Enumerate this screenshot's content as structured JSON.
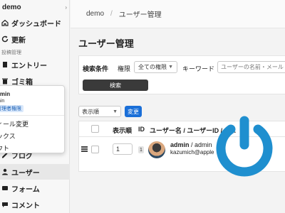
{
  "sidebar": {
    "site_name": "demo",
    "chevron": "›",
    "items_top": [
      {
        "label": "ダッシュボード",
        "icon": "home-icon"
      },
      {
        "label": "更新",
        "icon": "refresh-icon"
      }
    ],
    "section_label": "投稿管理",
    "items": [
      {
        "label": "エントリー",
        "icon": "document-icon"
      },
      {
        "label": "ゴミ箱",
        "icon": "trash-icon"
      },
      {
        "label": "ブログ",
        "icon": "blog-icon"
      },
      {
        "label": "ユーザー",
        "icon": "user-icon"
      },
      {
        "label": "フォーム",
        "icon": "form-icon"
      },
      {
        "label": "コメント",
        "icon": "comment-icon"
      }
    ]
  },
  "user_menu": {
    "name": "dmin",
    "id": "min",
    "role": "管理者権限",
    "items": [
      "ィール変更",
      "ックス",
      "ウト"
    ]
  },
  "breadcrumb": {
    "root": "demo",
    "separator": "/",
    "current": "ユーザー管理"
  },
  "page_title": "ユーザー管理",
  "search": {
    "title": "検索条件",
    "authority_label": "権限",
    "authority_value": "全ての権限",
    "keyword_label": "キーワード",
    "keyword_placeholder": "ユーザーの名前・メール",
    "button_label": "検索"
  },
  "bulk": {
    "select_value": "表示順",
    "change_label": "変更"
  },
  "table": {
    "headers": {
      "order": "表示順",
      "id": "ID",
      "user": "ユーザー名 / ユーザーID / メ..."
    },
    "rows": [
      {
        "order": "1",
        "id": "1",
        "name": "admin",
        "user_id": "admin",
        "email": "kazumich@apple"
      }
    ]
  },
  "colors": {
    "accent": "#1a6fd8",
    "power_icon": "#1f8fcf"
  }
}
